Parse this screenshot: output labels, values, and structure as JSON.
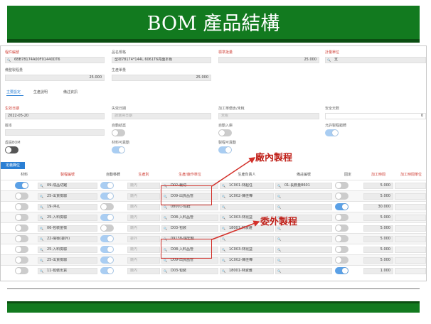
{
  "slide": {
    "title": "BOM 產品結構",
    "callout_inhouse": "廠內製程",
    "callout_outsource": "委外製程",
    "accent_green": "#127a1f",
    "callout_red": "#c0211a"
  },
  "form": {
    "item_no_label": "程件編號",
    "item_no": "6BB78174A00F01440DT6",
    "name_spec_label": "品名規格",
    "name_spec": "型材78174*144L 6061T6亮面本色",
    "std_qty_label": "標準批量",
    "std_qty": "25.000",
    "unit_label": "計量單位",
    "unit": "支",
    "prep_qty_label": "備整製程量",
    "prep_qty": "25.000",
    "prod_qty_label": "生產單量",
    "prod_qty": "25.000",
    "tabs": [
      "主要設定",
      "生產說明",
      "備註資訊"
    ],
    "effective_date_label": "生效日期",
    "effective_date": "2022-05-20",
    "expire_date_label": "失效日期",
    "expire_date_placeholder": "請選擇日期",
    "work_order_label": "加工單價含/未稅",
    "work_order_value": "未稅",
    "safety_days_label": "安全天數",
    "safety_days": "0",
    "version_label": "版本",
    "auto_close_label": "自動結案",
    "auto_stock_label": "自動入庫",
    "allow_change_label": "允許製程錯轉",
    "virtual_bom_label": "虛設BOM",
    "material_move_label": "材料可異動",
    "process_move_label": "製程可異動"
  },
  "grid": {
    "button_label": "定義欄位",
    "headers": [
      "材料",
      "製程編號",
      "自動移轉",
      "生產別",
      "生產/廠作單位",
      "生產負責人",
      "備註編號",
      "固定",
      "加工時間",
      "加工時間單位"
    ],
    "rows": [
      {
        "process": "09-成品切鋸",
        "kind": "廠內",
        "unit": "D02-裁切",
        "owner": "1C001-林超任",
        "remark": "01-長數量8601",
        "time": "5.000"
      },
      {
        "process": "25-出貨檢驗",
        "kind": "廠內",
        "unit": "D09-出貨品管",
        "owner": "1C002-陳佳樺",
        "remark": "",
        "time": "5.000"
      },
      {
        "process": "19-沖孔",
        "kind": "廠內",
        "unit": "08001-協群",
        "owner": "",
        "remark": "",
        "time": "30.000"
      },
      {
        "process": "25-入料檢驗",
        "kind": "廠內",
        "unit": "D08-入料品管",
        "owner": "1C003-林昆益",
        "remark": "",
        "time": "5.000"
      },
      {
        "process": "06-包裝金檢",
        "kind": "廠內",
        "unit": "D03-包裝",
        "owner": "18001-林淑雅",
        "remark": "",
        "time": "5.000"
      },
      {
        "process": "22-陽極(委外)",
        "kind": "委外",
        "unit": "09138-瑞宏動",
        "owner": "",
        "remark": "",
        "time": "5.000"
      },
      {
        "process": "25-入料檢驗",
        "kind": "廠內",
        "unit": "D08-入料品管",
        "owner": "1C003-林昆益",
        "remark": "",
        "time": "5.000"
      },
      {
        "process": "25-出貨檢驗",
        "kind": "廠內",
        "unit": "D09-出貨品管",
        "owner": "1C002-陳佳樺",
        "remark": "",
        "time": "5.000"
      },
      {
        "process": "11-包裝出貨",
        "kind": "廠內",
        "unit": "D03-包裝",
        "owner": "18001-林淑雅",
        "remark": "",
        "time": "1.000"
      }
    ]
  }
}
